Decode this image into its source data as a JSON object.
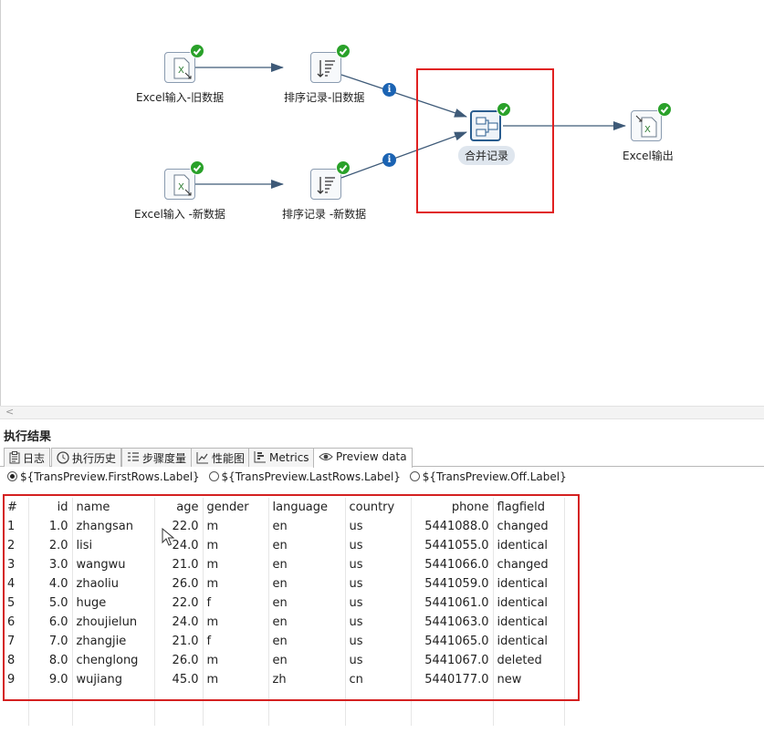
{
  "flow": {
    "steps": {
      "excel_in_old": "Excel输入-旧数据",
      "sort_old": "排序记录-旧数据",
      "excel_in_new": "Excel输入 -新数据",
      "sort_new": "排序记录 -新数据",
      "merge": "合并记录",
      "excel_out": "Excel输出"
    },
    "info_glyph": "i"
  },
  "results": {
    "title": "执行结果",
    "tabs": [
      {
        "label": "日志",
        "icon": "clipboard-icon"
      },
      {
        "label": "执行历史",
        "icon": "clock-icon"
      },
      {
        "label": "步骤度量",
        "icon": "list-icon"
      },
      {
        "label": "性能图",
        "icon": "line-chart-icon"
      },
      {
        "label": "Metrics",
        "icon": "bar-chart-icon"
      },
      {
        "label": "Preview data",
        "icon": "eye-icon"
      }
    ],
    "active_tab": "Preview data",
    "radios": [
      {
        "label": "${TransPreview.FirstRows.Label}",
        "selected": true
      },
      {
        "label": "${TransPreview.LastRows.Label}",
        "selected": false
      },
      {
        "label": "${TransPreview.Off.Label}",
        "selected": false
      }
    ]
  },
  "preview_table": {
    "columns": [
      "#",
      "id",
      "name",
      "age",
      "gender",
      "language",
      "country",
      "phone",
      "flagfield"
    ],
    "rows": [
      [
        "1",
        "1.0",
        "zhangsan",
        "22.0",
        "m",
        "en",
        "us",
        "5441088.0",
        "changed"
      ],
      [
        "2",
        "2.0",
        "lisi",
        "24.0",
        "m",
        "en",
        "us",
        "5441055.0",
        "identical"
      ],
      [
        "3",
        "3.0",
        "wangwu",
        "21.0",
        "m",
        "en",
        "us",
        "5441066.0",
        "changed"
      ],
      [
        "4",
        "4.0",
        "zhaoliu",
        "26.0",
        "m",
        "en",
        "us",
        "5441059.0",
        "identical"
      ],
      [
        "5",
        "5.0",
        "huge",
        "22.0",
        "f",
        "en",
        "us",
        "5441061.0",
        "identical"
      ],
      [
        "6",
        "6.0",
        "zhoujielun",
        "24.0",
        "m",
        "en",
        "us",
        "5441063.0",
        "identical"
      ],
      [
        "7",
        "7.0",
        "zhangjie",
        "21.0",
        "f",
        "en",
        "us",
        "5441065.0",
        "identical"
      ],
      [
        "8",
        "8.0",
        "chenglong",
        "26.0",
        "m",
        "en",
        "us",
        "5441067.0",
        "deleted"
      ],
      [
        "9",
        "9.0",
        "wujiang",
        "45.0",
        "m",
        "zh",
        "cn",
        "5440177.0",
        "new"
      ]
    ]
  },
  "colors": {
    "hop": "#3e5a78",
    "ok": "#2aa12a",
    "info": "#1b63b3",
    "highlight": "#e02020"
  }
}
